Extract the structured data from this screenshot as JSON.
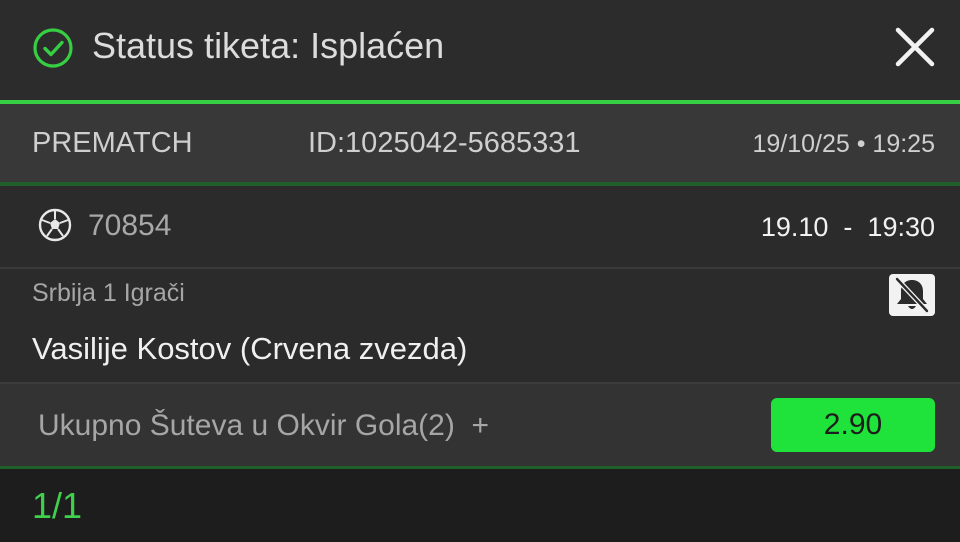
{
  "header": {
    "title": "Status tiketa: Isplaćen",
    "status_icon": "check-circle-icon",
    "close_icon": "close-icon"
  },
  "ticket": {
    "type": "PREMATCH",
    "id": "ID:1025042-5685331",
    "datetime": "19/10/25 • 19:25"
  },
  "match": {
    "sport_icon": "soccer-ball-icon",
    "code": "70854",
    "time": "19.10  -  19:30"
  },
  "event": {
    "league": "Srbija 1 Igrači",
    "player": "Vasilije Kostov (Crvena zvezda)",
    "notification_icon": "bell-off-icon"
  },
  "bet": {
    "market": "Ukupno Šuteva u Okvir Gola(2)  +",
    "odds": "2.90"
  },
  "footer": {
    "count": "1/1"
  },
  "colors": {
    "accent_green": "#36cf43",
    "odds_green": "#1fe23a",
    "footer_text_green": "#3fd14c",
    "background": "#2b2b2b"
  }
}
